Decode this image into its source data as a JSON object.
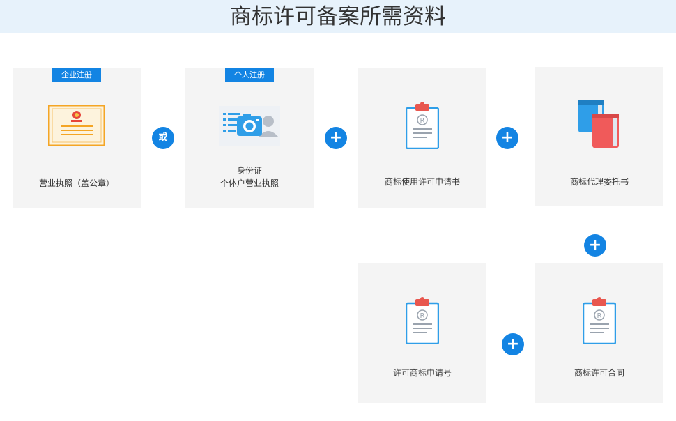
{
  "header": {
    "title": "商标许可备案所需资料"
  },
  "cards": {
    "business_license": {
      "tag": "企业注册",
      "label": "营业执照（盖公章）"
    },
    "id_card": {
      "tag": "个人注册",
      "label_line1": "身份证",
      "label_line2": "个体户营业执照"
    },
    "license_application": {
      "label": "商标使用许可申请书"
    },
    "power_of_attorney": {
      "label": "商标代理委托书"
    },
    "license_number": {
      "label": "许可商标申请号"
    },
    "license_contract": {
      "label": "商标许可合同"
    }
  },
  "connectors": {
    "or": "或",
    "plus": "+"
  },
  "icons": {
    "business_license": "certificate-icon",
    "id_card": "id-camera-icon",
    "license_application": "clipboard-icon",
    "power_of_attorney": "books-icon",
    "license_number": "clipboard-icon",
    "license_contract": "clipboard-icon"
  },
  "colors": {
    "accent": "#1384e3",
    "card_bg": "#f4f4f4",
    "header_bg": "#e7f2fb",
    "certificate_border": "#f4a525",
    "clipboard_clip": "#e8574f",
    "book_blue": "#2f9ee8",
    "book_red": "#f05a5a"
  }
}
